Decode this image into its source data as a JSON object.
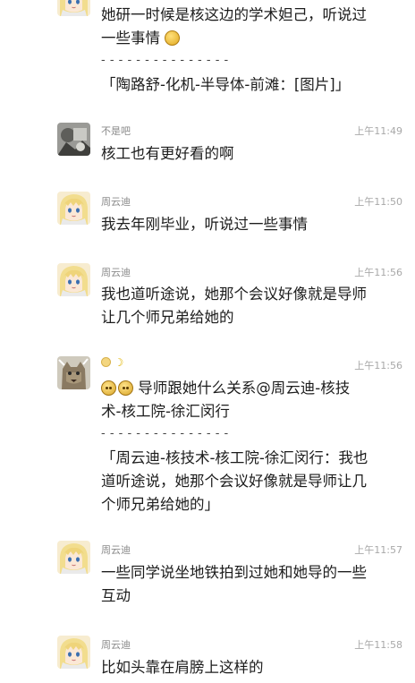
{
  "messages": [
    {
      "id": "m0",
      "sender": "",
      "time": "",
      "avatar": "anime-girl-avatar",
      "lines": [
        "她研一时候是核这边的学术妲己，听说过",
        "一些事情"
      ],
      "separator": "- - - - - - - - - - - - - - -",
      "quote": [
        "「陶路舒-化机-半导体-前滩：[图片]」"
      ]
    },
    {
      "id": "m1",
      "sender": "不是吧",
      "time": "上午11:49",
      "avatar": "gray-photo-avatar",
      "lines": [
        "核工也有更好看的啊"
      ]
    },
    {
      "id": "m2",
      "sender": "周云迪",
      "time": "上午11:50",
      "avatar": "anime-girl-avatar",
      "lines": [
        "我去年刚毕业，听说过一些事情"
      ]
    },
    {
      "id": "m3",
      "sender": "周云迪",
      "time": "上午11:56",
      "avatar": "anime-girl-avatar",
      "lines": [
        "我也道听途说，她那个会议好像就是导师",
        "让几个师兄弟给她的"
      ]
    },
    {
      "id": "m4",
      "sender": "",
      "time": "上午11:56",
      "avatar": "cat-photo-avatar",
      "lines": [
        "导师跟她什么关系@周云迪-核技",
        "术-核工院-徐汇闵行"
      ],
      "separator": "- - - - - - - - - - - - - - -",
      "quote": [
        "「周云迪-核技术-核工院-徐汇闵行：我也",
        "道听途说，她那个会议好像就是导师让几",
        "个师兄弟给她的」"
      ]
    },
    {
      "id": "m5",
      "sender": "周云迪",
      "time": "上午11:57",
      "avatar": "anime-girl-avatar",
      "lines": [
        "一些同学说坐地铁拍到过她和她导的一些",
        "互动"
      ]
    },
    {
      "id": "m6",
      "sender": "周云迪",
      "time": "上午11:58",
      "avatar": "anime-girl-avatar",
      "lines": [
        "比如头靠在肩膀上这样的"
      ]
    }
  ],
  "colors": {
    "text": "#1c1c1c",
    "meta": "#8a8a8a",
    "time": "#a8a8a8"
  }
}
